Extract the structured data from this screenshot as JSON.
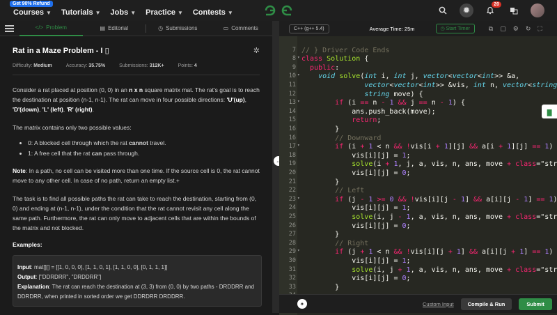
{
  "header": {
    "refund_badge": "Get 90% Refund",
    "nav": [
      "Courses",
      "Tutorials",
      "Jobs",
      "Practice",
      "Contests"
    ],
    "notifications_count": "20",
    "icons": [
      "search-icon",
      "theme-toggle-icon",
      "bell-icon",
      "translate-icon",
      "avatar"
    ]
  },
  "problem_tabs": {
    "problem": "Problem",
    "editorial": "Editorial",
    "submissions": "Submissions",
    "comments": "Comments"
  },
  "problem": {
    "title": "Rat in a Maze Problem - I",
    "difficulty_label": "Difficulty:",
    "difficulty": "Medium",
    "accuracy_label": "Accuracy:",
    "accuracy": "35.75%",
    "submissions_label": "Submissions:",
    "submissions": "312K+",
    "points_label": "Points:",
    "points": "4",
    "para1_a": "Consider a rat placed at position (0, 0) in an ",
    "para1_b": "n x n",
    "para1_c": " square matrix mat. The rat's goal is to reach the destination at position (n-1, n-1). The rat can move in four possible directions: ",
    "para1_d": "'U'(up)",
    "para1_e": ", ",
    "para1_f": "'D'(down)",
    "para1_g": ", ",
    "para1_h": "'L' (left)",
    "para1_i": ", ",
    "para1_j": "'R' (right)",
    "para1_k": ".",
    "para2": "The matrix contains only two possible values:",
    "bullet1_a": "0: A blocked cell through which the rat ",
    "bullet1_b": "cannot",
    "bullet1_c": " travel.",
    "bullet2_a": "1: A free cell that the rat ",
    "bullet2_b": "can",
    "bullet2_c": " pass through.",
    "note_label": "Note",
    "note_text": ": In a path, no cell can be visited more than one time. If the source cell is 0, the rat cannot move to any other cell. In case of no path, return an empty list.+",
    "para3": "The task is to find all possible paths the rat can take to reach the destination, starting from (0, 0) and ending at (n-1, n-1), under the condition that the rat cannot revisit any cell along the same path. Furthermore, the rat can only move to adjacent cells that are within the bounds of the matrix and not blocked.",
    "examples_heading": "Examples:",
    "example": {
      "input_label": "Input",
      "input": ": mat[][] = [[1, 0, 0, 0], [1, 1, 0, 1], [1, 1, 0, 0], [0, 1, 1, 1]]",
      "output_label": "Output",
      "output": ": [\"DDRDRR\", \"DRDDRR\"]",
      "explanation_label": "Explanation",
      "explanation": ": The rat can reach the destination at (3, 3) from (0, 0) by two paths - DRDDRR and DDRDRR, when printed in sorted order we get DDRDRR DRDDRR."
    }
  },
  "editor": {
    "language": "C++ (g++ 5.4)",
    "avg_time": "Average Time: 25m",
    "timer": "Start Timer",
    "custom_input": "Custom Input",
    "compile_run": "Compile & Run",
    "submit": "Submit",
    "lines": [
      {
        "n": "",
        "fold": "",
        "t": ""
      },
      {
        "n": "7",
        "fold": "",
        "t": "// } Driver Code Ends"
      },
      {
        "n": "8",
        "fold": "▾",
        "t": "class Solution {"
      },
      {
        "n": "9",
        "fold": "",
        "t": "  public:"
      },
      {
        "n": "10",
        "fold": "▾",
        "t": "    void solve(int i, int j, vector<vector<int>> &a,"
      },
      {
        "n": "11",
        "fold": "",
        "t": "               vector<vector<int>> &vis, int n, vector<string> &ans,"
      },
      {
        "n": "12",
        "fold": "",
        "t": "               string move) {"
      },
      {
        "n": "13",
        "fold": "▾",
        "t": "        if (i == n - 1 && j == n - 1) {"
      },
      {
        "n": "14",
        "fold": "",
        "t": "            ans.push_back(move);"
      },
      {
        "n": "15",
        "fold": "",
        "t": "            return;"
      },
      {
        "n": "16",
        "fold": "",
        "t": "        }"
      },
      {
        "n": "16",
        "fold": "",
        "t": "        // Downward"
      },
      {
        "n": "17",
        "fold": "▾",
        "t": "        if (i + 1 < n && !vis[i + 1][j] && a[i + 1][j] == 1) {"
      },
      {
        "n": "18",
        "fold": "",
        "t": "            vis[i][j] = 1;"
      },
      {
        "n": "19",
        "fold": "",
        "t": "            solve(i + 1, j, a, vis, n, ans, move + 'D');"
      },
      {
        "n": "20",
        "fold": "",
        "t": "            vis[i][j] = 0;"
      },
      {
        "n": "21",
        "fold": "",
        "t": "        }"
      },
      {
        "n": "22",
        "fold": "",
        "t": "        // Left"
      },
      {
        "n": "23",
        "fold": "▾",
        "t": "        if (j - 1 >= 0 && !vis[i][j - 1] && a[i][j - 1] == 1) {"
      },
      {
        "n": "24",
        "fold": "",
        "t": "            vis[i][j] = 1;"
      },
      {
        "n": "25",
        "fold": "",
        "t": "            solve(i, j - 1, a, vis, n, ans, move + 'L');"
      },
      {
        "n": "26",
        "fold": "",
        "t": "            vis[i][j] = 0;"
      },
      {
        "n": "27",
        "fold": "",
        "t": "        }"
      },
      {
        "n": "28",
        "fold": "",
        "t": "        // Right"
      },
      {
        "n": "29",
        "fold": "▾",
        "t": "        if (j + 1 < n && !vis[i][j + 1] && a[i][j + 1] == 1) {"
      },
      {
        "n": "30",
        "fold": "",
        "t": "            vis[i][j] = 1;"
      },
      {
        "n": "31",
        "fold": "",
        "t": "            solve(i, j + 1, a, vis, n, ans, move + 'R');"
      },
      {
        "n": "32",
        "fold": "",
        "t": "            vis[i][j] = 0;"
      },
      {
        "n": "33",
        "fold": "",
        "t": "        }"
      },
      {
        "n": "34",
        "fold": "",
        "t": ""
      }
    ]
  },
  "colors": {
    "accent_green": "#2f8d46",
    "badge_blue": "#1f6feb",
    "notif_red": "#d93025"
  }
}
